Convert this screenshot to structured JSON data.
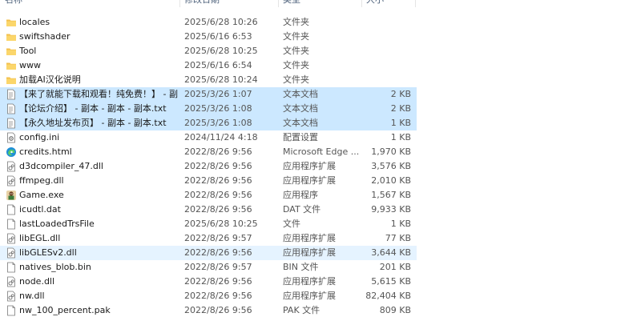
{
  "columns": {
    "name": "名称",
    "date": "修改日期",
    "type": "类型",
    "size": "大小"
  },
  "rows": [
    {
      "name": "locales",
      "date": "2025/6/28 10:26",
      "type": "文件夹",
      "size": "",
      "icon": "folder-icon",
      "state": "normal"
    },
    {
      "name": "swiftshader",
      "date": "2025/6/16 6:53",
      "type": "文件夹",
      "size": "",
      "icon": "folder-icon",
      "state": "normal"
    },
    {
      "name": "Tool",
      "date": "2025/6/28 10:25",
      "type": "文件夹",
      "size": "",
      "icon": "folder-icon",
      "state": "normal"
    },
    {
      "name": "www",
      "date": "2025/6/16 6:54",
      "type": "文件夹",
      "size": "",
      "icon": "folder-icon",
      "state": "normal"
    },
    {
      "name": "加载AI汉化说明",
      "date": "2025/6/28 10:24",
      "type": "文件夹",
      "size": "",
      "icon": "folder-icon",
      "state": "normal"
    },
    {
      "name": "【来了就能下载和观看！纯免费！】 - 副...",
      "date": "2025/3/26 1:07",
      "type": "文本文档",
      "size": "2 KB",
      "icon": "text-file-icon",
      "state": "selected"
    },
    {
      "name": "【论坛介绍】 - 副本 - 副本 - 副本.txt",
      "date": "2025/3/26 1:08",
      "type": "文本文档",
      "size": "2 KB",
      "icon": "text-file-icon",
      "state": "selected"
    },
    {
      "name": "【永久地址发布页】 - 副本 - 副本.txt",
      "date": "2025/3/26 1:08",
      "type": "文本文档",
      "size": "1 KB",
      "icon": "text-file-icon",
      "state": "selected"
    },
    {
      "name": "config.ini",
      "date": "2024/11/24 4:18",
      "type": "配置设置",
      "size": "1 KB",
      "icon": "settings-file-icon",
      "state": "normal"
    },
    {
      "name": "credits.html",
      "date": "2022/8/26 9:56",
      "type": "Microsoft Edge ...",
      "size": "1,970 KB",
      "icon": "edge-icon",
      "state": "normal"
    },
    {
      "name": "d3dcompiler_47.dll",
      "date": "2022/8/26 9:56",
      "type": "应用程序扩展",
      "size": "3,576 KB",
      "icon": "dll-icon",
      "state": "normal"
    },
    {
      "name": "ffmpeg.dll",
      "date": "2022/8/26 9:56",
      "type": "应用程序扩展",
      "size": "2,010 KB",
      "icon": "dll-icon",
      "state": "normal"
    },
    {
      "name": "Game.exe",
      "date": "2022/8/26 9:56",
      "type": "应用程序",
      "size": "1,567 KB",
      "icon": "game-exe-icon",
      "state": "normal"
    },
    {
      "name": "icudtl.dat",
      "date": "2022/8/26 9:56",
      "type": "DAT 文件",
      "size": "9,933 KB",
      "icon": "blank-file-icon",
      "state": "normal"
    },
    {
      "name": "lastLoadedTrsFile",
      "date": "2025/6/28 10:25",
      "type": "文件",
      "size": "1 KB",
      "icon": "blank-file-icon",
      "state": "normal"
    },
    {
      "name": "libEGL.dll",
      "date": "2022/8/26 9:57",
      "type": "应用程序扩展",
      "size": "77 KB",
      "icon": "dll-icon",
      "state": "normal"
    },
    {
      "name": "libGLESv2.dll",
      "date": "2022/8/26 9:56",
      "type": "应用程序扩展",
      "size": "3,644 KB",
      "icon": "dll-icon",
      "state": "hover"
    },
    {
      "name": "natives_blob.bin",
      "date": "2022/8/26 9:57",
      "type": "BIN 文件",
      "size": "201 KB",
      "icon": "blank-file-icon",
      "state": "normal"
    },
    {
      "name": "node.dll",
      "date": "2022/8/26 9:56",
      "type": "应用程序扩展",
      "size": "5,615 KB",
      "icon": "dll-icon",
      "state": "normal"
    },
    {
      "name": "nw.dll",
      "date": "2022/8/26 9:56",
      "type": "应用程序扩展",
      "size": "82,404 KB",
      "icon": "dll-icon",
      "state": "normal"
    },
    {
      "name": "nw_100_percent.pak",
      "date": "2022/8/26 9:56",
      "type": "PAK 文件",
      "size": "809 KB",
      "icon": "blank-file-icon",
      "state": "normal"
    }
  ]
}
